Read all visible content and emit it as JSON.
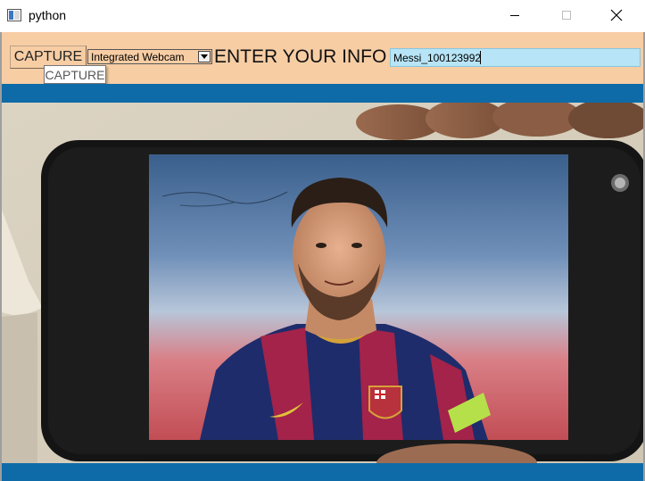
{
  "window": {
    "title": "python",
    "controls": {
      "minimize": "minimize-icon",
      "maximize": "maximize-icon",
      "close": "close-icon"
    }
  },
  "toolbar": {
    "capture_label": "CAPTURE",
    "camera_select": {
      "selected": "Integrated Webcam"
    },
    "info_label": "ENTER YOUR INFO :",
    "info_input_value": "Messi_100123992"
  },
  "tooltip": {
    "text": "CAPTURE"
  },
  "colors": {
    "toolbar_bg": "#f7cda4",
    "accent_bar": "#0e6ba8",
    "input_bg": "#b7e4f6"
  },
  "feed": {
    "description_icon": "camera-feed-image"
  }
}
